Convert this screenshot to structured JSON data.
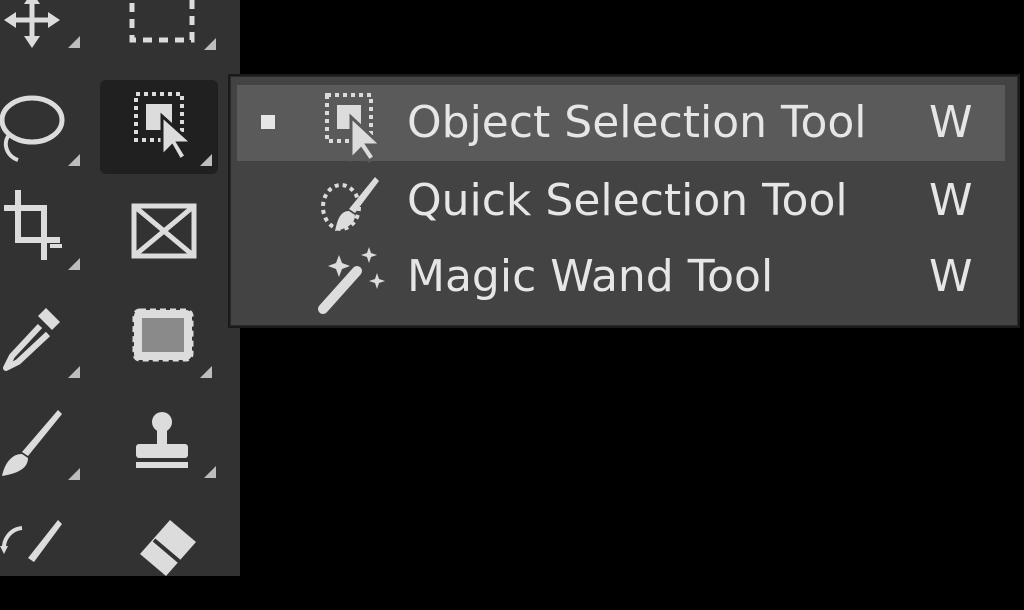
{
  "toolbar": {
    "tools": [
      {
        "icon": "move-icon"
      },
      {
        "icon": "rectangular-marquee-icon"
      },
      {
        "icon": "lasso-icon"
      },
      {
        "icon": "object-selection-icon",
        "active": true
      },
      {
        "icon": "crop-icon"
      },
      {
        "icon": "frame-icon"
      },
      {
        "icon": "eyedropper-icon"
      },
      {
        "icon": "spot-healing-icon"
      },
      {
        "icon": "brush-icon"
      },
      {
        "icon": "clone-stamp-icon"
      },
      {
        "icon": "history-brush-icon"
      },
      {
        "icon": "eraser-icon"
      }
    ]
  },
  "flyout": {
    "items": [
      {
        "label": "Object Selection Tool",
        "shortcut": "W",
        "icon": "object-selection-icon",
        "selected": true
      },
      {
        "label": "Quick Selection Tool",
        "shortcut": "W",
        "icon": "quick-selection-icon",
        "selected": false
      },
      {
        "label": "Magic Wand Tool",
        "shortcut": "W",
        "icon": "magic-wand-icon",
        "selected": false
      }
    ]
  },
  "colors": {
    "toolbar_bg": "#323232",
    "flyout_bg": "#434343",
    "selected_bg": "#5a5a5a",
    "text": "#e6e6e6",
    "canvas": "#000000"
  }
}
